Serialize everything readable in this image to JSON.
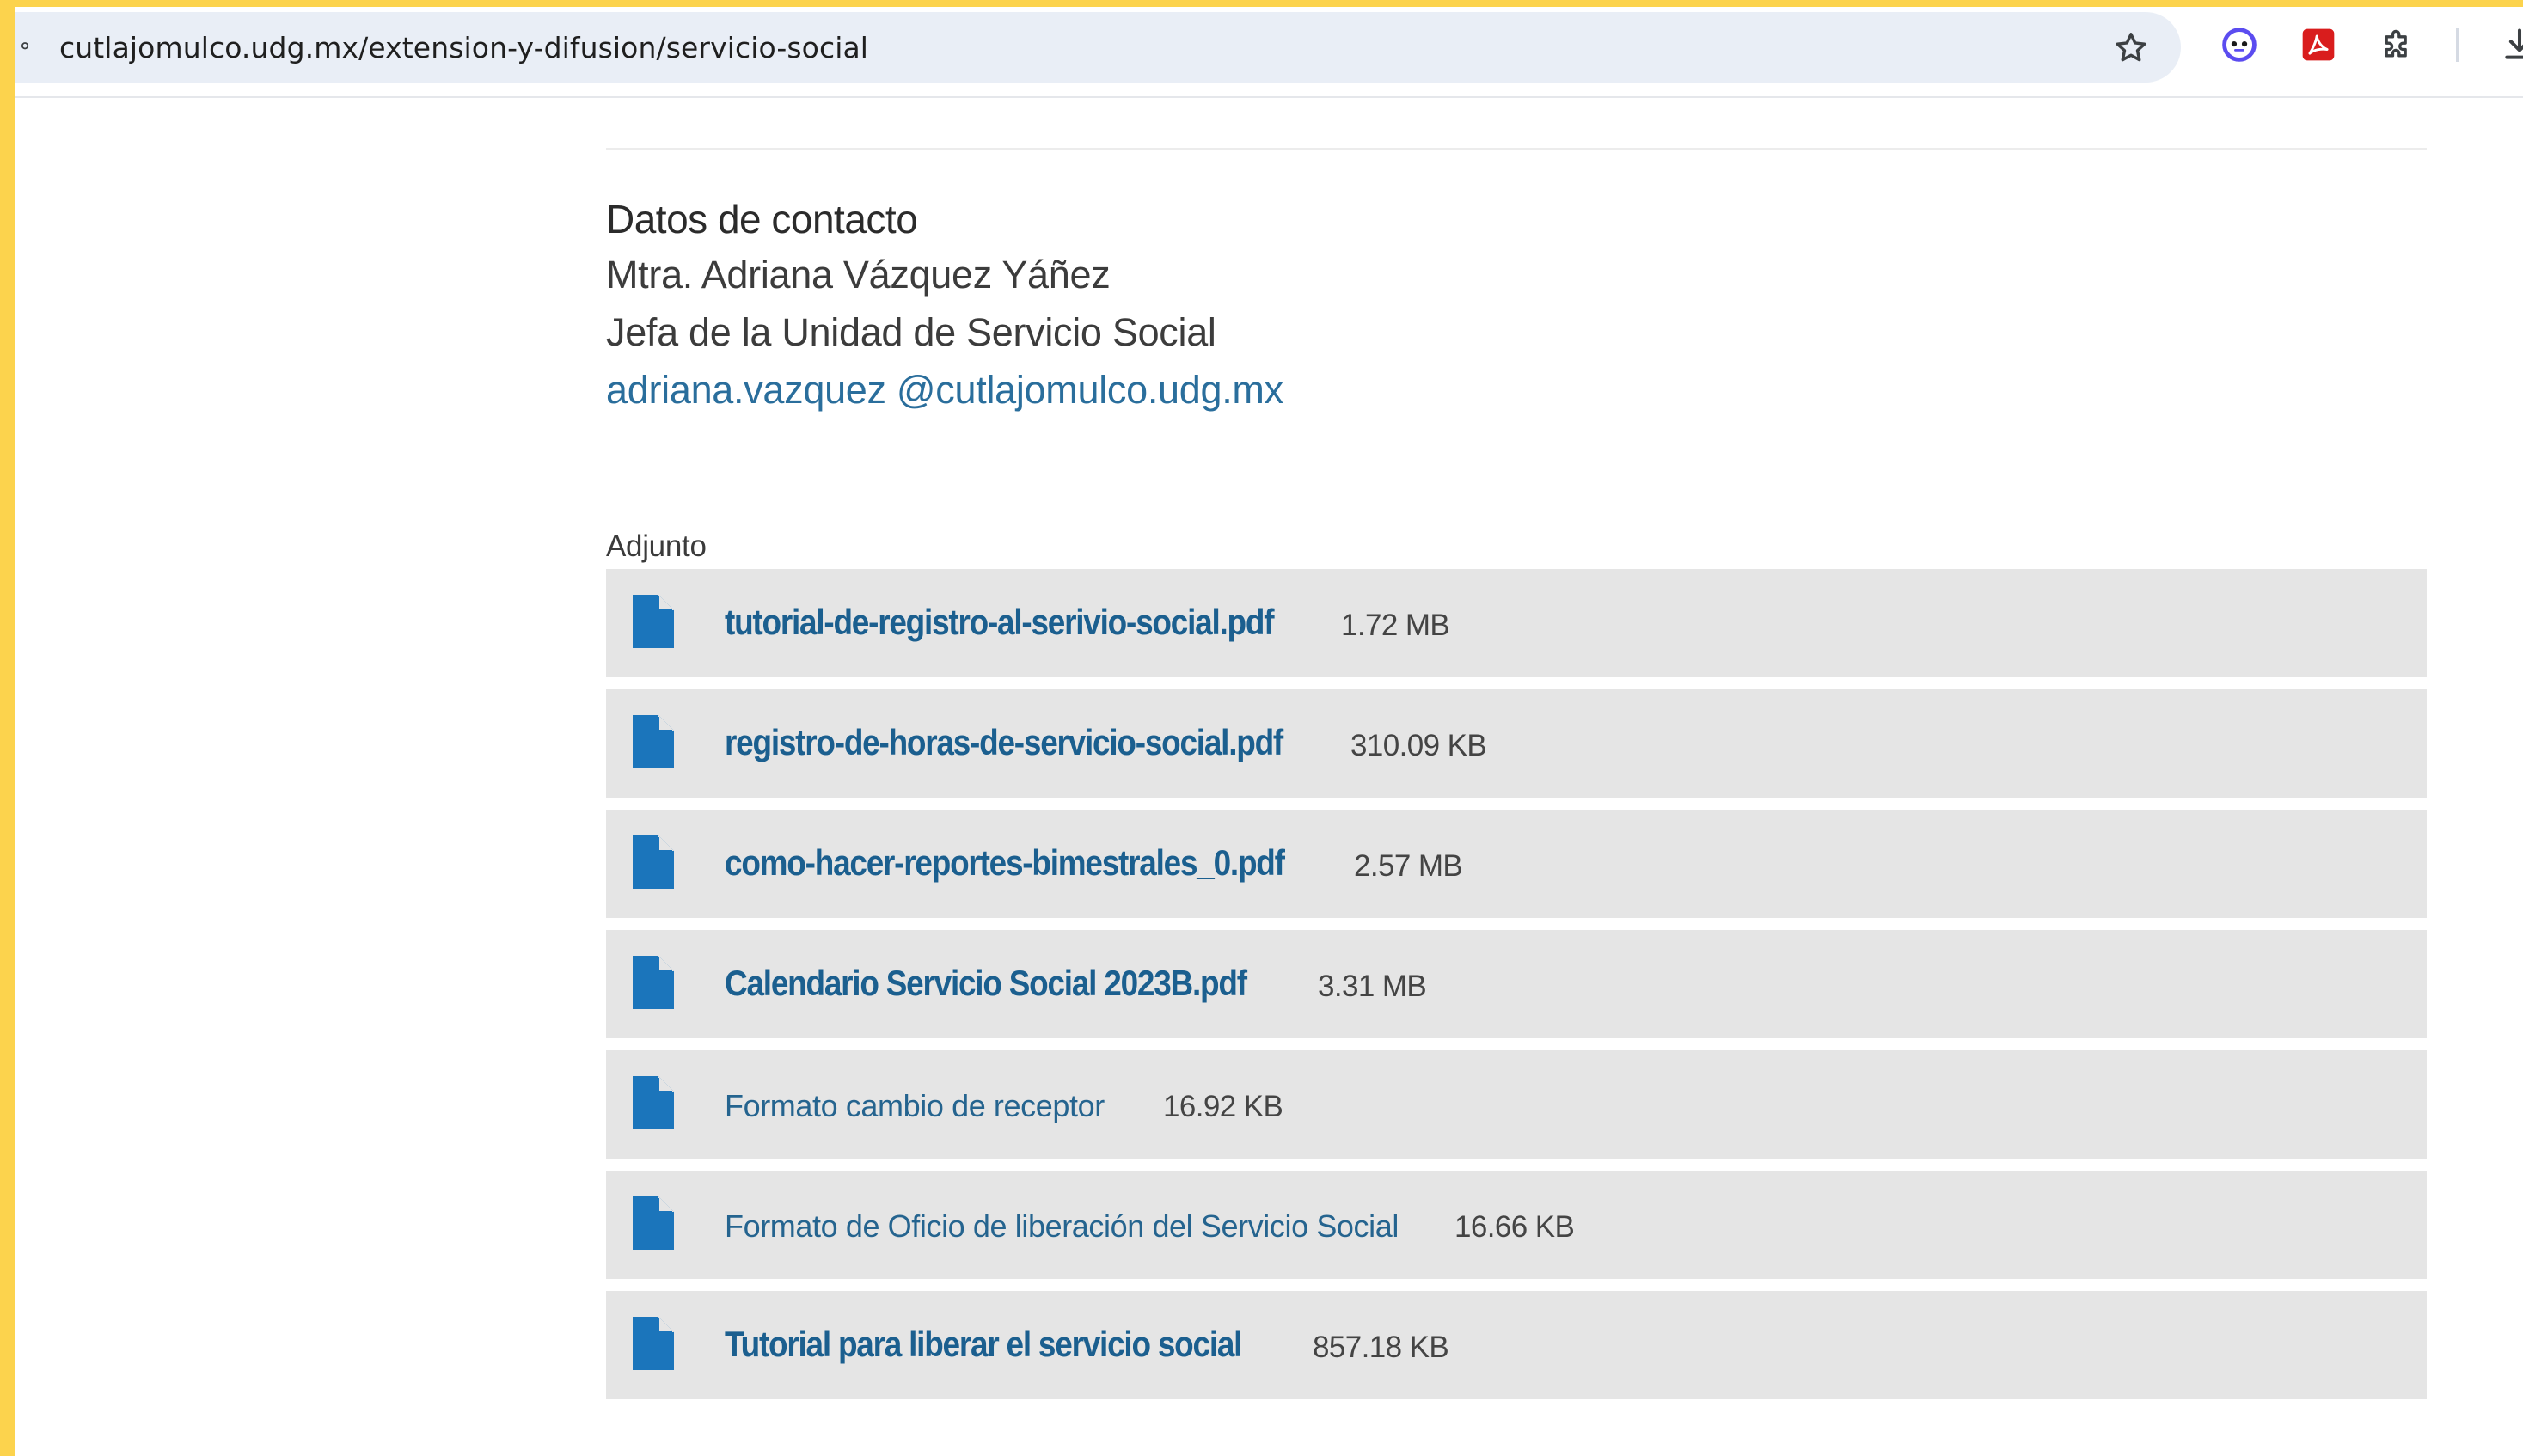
{
  "browser": {
    "url": "cutlajomulco.udg.mx/extension-y-difusion/servicio-social",
    "icons": [
      "site-info-icon",
      "bookmark-star-icon",
      "extension-face-icon",
      "adobe-pdf-icon",
      "extensions-puzzle-icon",
      "download-icon"
    ],
    "colors": {
      "frame": "#fcd34d",
      "omnibox": "#e9eef6"
    }
  },
  "contact": {
    "title": "Datos de contacto",
    "name": "Mtra. Adriana Vázquez Yáñez",
    "role": "Jefa de la Unidad de Servicio Social",
    "email": "adriana.vazquez @cutlajomulco.udg.mx"
  },
  "attachments": {
    "label": "Adjunto",
    "items": [
      {
        "name": "tutorial-de-registro-al-serivio-social.pdf",
        "size": "1.72 MB",
        "style": "condensed"
      },
      {
        "name": "registro-de-horas-de-servicio-social.pdf",
        "size": "310.09 KB",
        "style": "condensed"
      },
      {
        "name": "como-hacer-reportes-bimestrales_0.pdf",
        "size": "2.57 MB",
        "style": "condensed"
      },
      {
        "name": "Calendario Servicio Social 2023B.pdf",
        "size": "3.31 MB",
        "style": "condensed"
      },
      {
        "name": "Formato cambio de receptor",
        "size": "16.92 KB",
        "style": "regular"
      },
      {
        "name": "Formato de Oficio de liberación del Servicio Social",
        "size": "16.66 KB",
        "style": "regular"
      },
      {
        "name": "Tutorial para liberar el servicio social",
        "size": "857.18 KB",
        "style": "condensed"
      }
    ]
  },
  "colors": {
    "link": "#1b5f8f",
    "file_icon": "#1b75bb",
    "row_bg": "#e5e5e5"
  }
}
